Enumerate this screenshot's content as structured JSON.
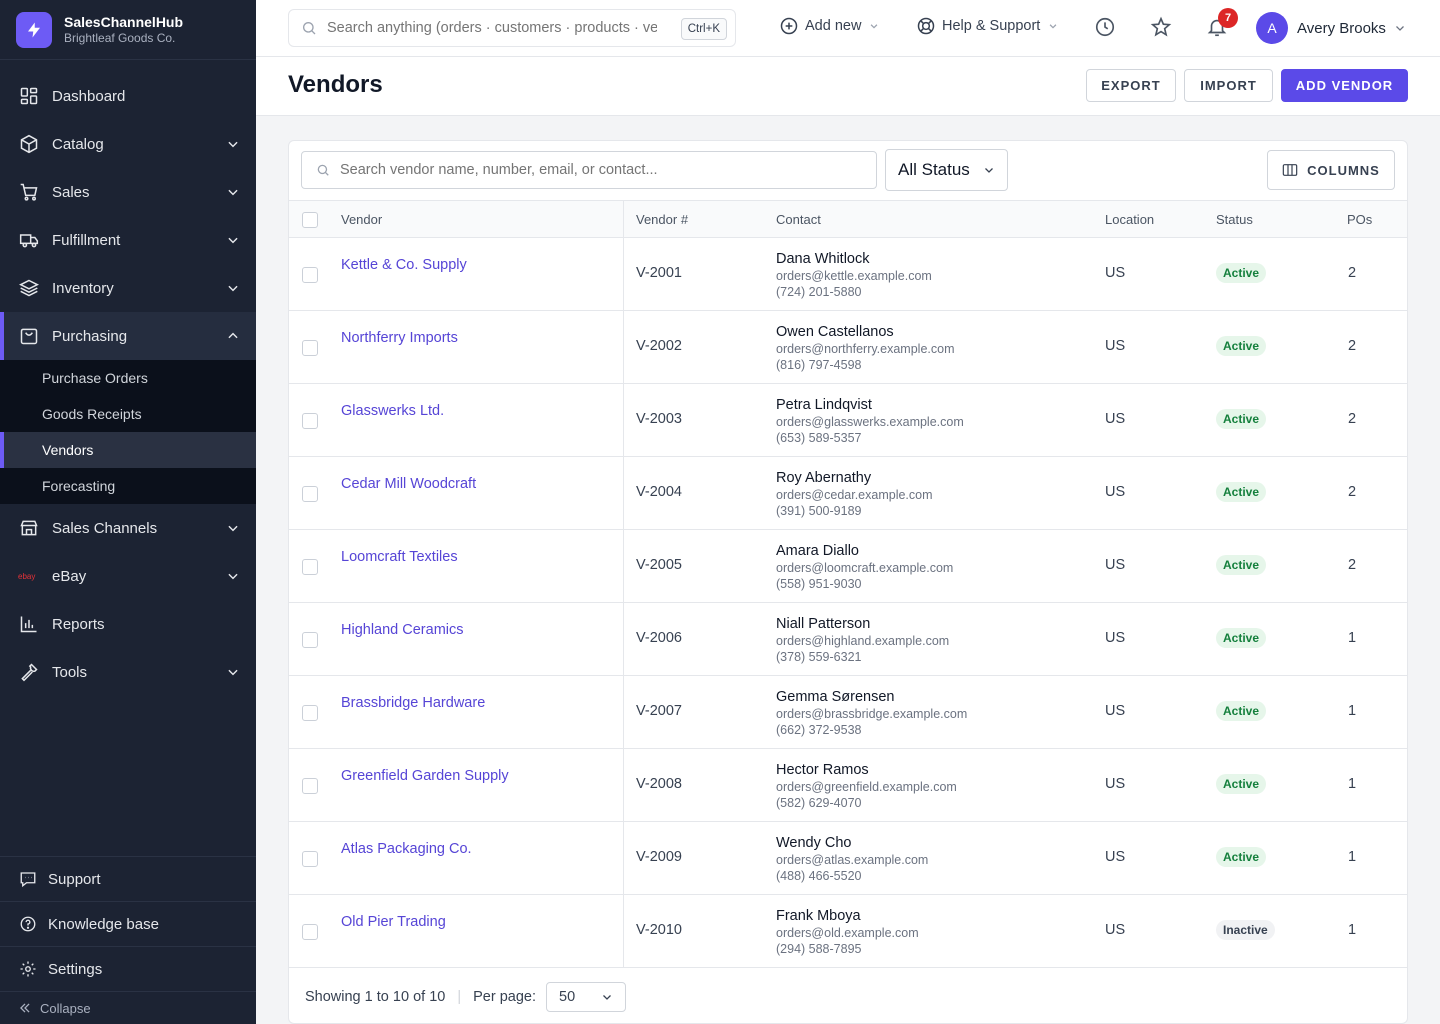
{
  "brand": {
    "name": "SalesChannelHub",
    "company": "Brightleaf Goods Co.",
    "icon": "lightning-icon"
  },
  "sidebar": {
    "items": [
      {
        "label": "Dashboard",
        "icon": "dashboard-icon"
      },
      {
        "label": "Catalog",
        "icon": "box-icon"
      },
      {
        "label": "Sales",
        "icon": "cart-icon"
      },
      {
        "label": "Fulfillment",
        "icon": "truck-icon"
      },
      {
        "label": "Inventory",
        "icon": "layers-icon"
      },
      {
        "label": "Purchasing",
        "icon": "bag-icon"
      },
      {
        "label": "Sales Channels",
        "icon": "store-icon"
      },
      {
        "label": "eBay",
        "icon": "ebay-logo"
      },
      {
        "label": "Reports",
        "icon": "bar-chart-icon"
      },
      {
        "label": "Tools",
        "icon": "wrench-icon"
      }
    ],
    "purchasing_sub": [
      "Purchase Orders",
      "Goods Receipts",
      "Vendors",
      "Forecasting"
    ],
    "bottom": [
      {
        "label": "Support",
        "icon": "chat-icon"
      },
      {
        "label": "Knowledge base",
        "icon": "help-circle-icon"
      },
      {
        "label": "Settings",
        "icon": "gear-icon"
      }
    ],
    "collapse_label": "Collapse",
    "ebay_logo_text": "ebay"
  },
  "topbar": {
    "search_placeholder": "Search anything (orders · customers · products · vendors)",
    "shortcut": "Ctrl+K",
    "add_new": "Add new",
    "help": "Help & Support",
    "notifications_count": "7",
    "user_initial": "A",
    "user_name": "Avery Brooks"
  },
  "page": {
    "title": "Vendors",
    "export_label": "EXPORT",
    "import_label": "IMPORT",
    "add_label": "ADD VENDOR"
  },
  "filters": {
    "search_placeholder": "Search vendor name, number, email, or contact...",
    "status_value": "All Status",
    "columns_label": "COLUMNS"
  },
  "table": {
    "headers": {
      "vendor": "Vendor",
      "number": "Vendor #",
      "contact": "Contact",
      "location": "Location",
      "status": "Status",
      "pos": "POs"
    },
    "rows": [
      {
        "vendor": "Kettle & Co. Supply",
        "number": "V-2001",
        "contact": "Dana Whitlock",
        "email": "orders@kettle.example.com",
        "phone": "(724) 201-5880",
        "location": "US",
        "status": "Active",
        "pos": "2"
      },
      {
        "vendor": "Northferry Imports",
        "number": "V-2002",
        "contact": "Owen Castellanos",
        "email": "orders@northferry.example.com",
        "phone": "(816) 797-4598",
        "location": "US",
        "status": "Active",
        "pos": "2"
      },
      {
        "vendor": "Glasswerks Ltd.",
        "number": "V-2003",
        "contact": "Petra Lindqvist",
        "email": "orders@glasswerks.example.com",
        "phone": "(653) 589-5357",
        "location": "US",
        "status": "Active",
        "pos": "2"
      },
      {
        "vendor": "Cedar Mill Woodcraft",
        "number": "V-2004",
        "contact": "Roy Abernathy",
        "email": "orders@cedar.example.com",
        "phone": "(391) 500-9189",
        "location": "US",
        "status": "Active",
        "pos": "2"
      },
      {
        "vendor": "Loomcraft Textiles",
        "number": "V-2005",
        "contact": "Amara Diallo",
        "email": "orders@loomcraft.example.com",
        "phone": "(558) 951-9030",
        "location": "US",
        "status": "Active",
        "pos": "2"
      },
      {
        "vendor": "Highland Ceramics",
        "number": "V-2006",
        "contact": "Niall Patterson",
        "email": "orders@highland.example.com",
        "phone": "(378) 559-6321",
        "location": "US",
        "status": "Active",
        "pos": "1"
      },
      {
        "vendor": "Brassbridge Hardware",
        "number": "V-2007",
        "contact": "Gemma Sørensen",
        "email": "orders@brassbridge.example.com",
        "phone": "(662) 372-9538",
        "location": "US",
        "status": "Active",
        "pos": "1"
      },
      {
        "vendor": "Greenfield Garden Supply",
        "number": "V-2008",
        "contact": "Hector Ramos",
        "email": "orders@greenfield.example.com",
        "phone": "(582) 629-4070",
        "location": "US",
        "status": "Active",
        "pos": "1"
      },
      {
        "vendor": "Atlas Packaging Co.",
        "number": "V-2009",
        "contact": "Wendy Cho",
        "email": "orders@atlas.example.com",
        "phone": "(488) 466-5520",
        "location": "US",
        "status": "Active",
        "pos": "1"
      },
      {
        "vendor": "Old Pier Trading",
        "number": "V-2010",
        "contact": "Frank Mboya",
        "email": "orders@old.example.com",
        "phone": "(294) 588-7895",
        "location": "US",
        "status": "Inactive",
        "pos": "1"
      }
    ]
  },
  "footer": {
    "showing_prefix": "Showing",
    "from": "1",
    "to_word": "to",
    "to": "10",
    "of_word": "of",
    "total": "10",
    "per_page_label": "Per page:",
    "per_page_value": "50"
  },
  "colors": {
    "accent": "#5b4ae8",
    "sidebar_bg": "#1c2333",
    "active_green": "#15803d",
    "badge_red": "#dc2626"
  }
}
